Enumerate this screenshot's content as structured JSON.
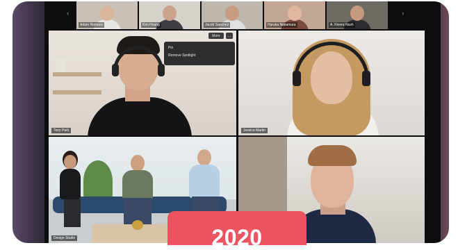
{
  "filmstrip": {
    "participants": [
      {
        "name": "Adam Romano",
        "bg": "#c9c1b7",
        "skin": "#d8b49a",
        "shirt": "#e8e6e2"
      },
      {
        "name": "Kim Hoang",
        "bg": "#d7d3cc",
        "skin": "#caa48a",
        "shirt": "#3e3e44"
      },
      {
        "name": "Jacob Sanchez",
        "bg": "#bdb7ae",
        "skin": "#c89c80",
        "shirt": "#e0e0e0"
      },
      {
        "name": "Haruka Nakamura",
        "bg": "#c2a894",
        "skin": "#e0b89e",
        "shirt": "#7a4a3e"
      },
      {
        "name": "A. Rivera Nash",
        "bg": "#6e6a64",
        "skin": "#c69a7e",
        "shirt": "#2c2c30"
      }
    ]
  },
  "grid": {
    "tile1": {
      "name": "Tony Park"
    },
    "tile2": {
      "name": "Jessica Martin"
    },
    "tile3": {
      "name": "Design Studio"
    },
    "tile4": {
      "name": ""
    }
  },
  "context_menu": {
    "more_label": "More",
    "items": [
      "Pin",
      "Remove Spotlight"
    ]
  },
  "badge": {
    "year": "2020",
    "color": "#ec5462"
  }
}
